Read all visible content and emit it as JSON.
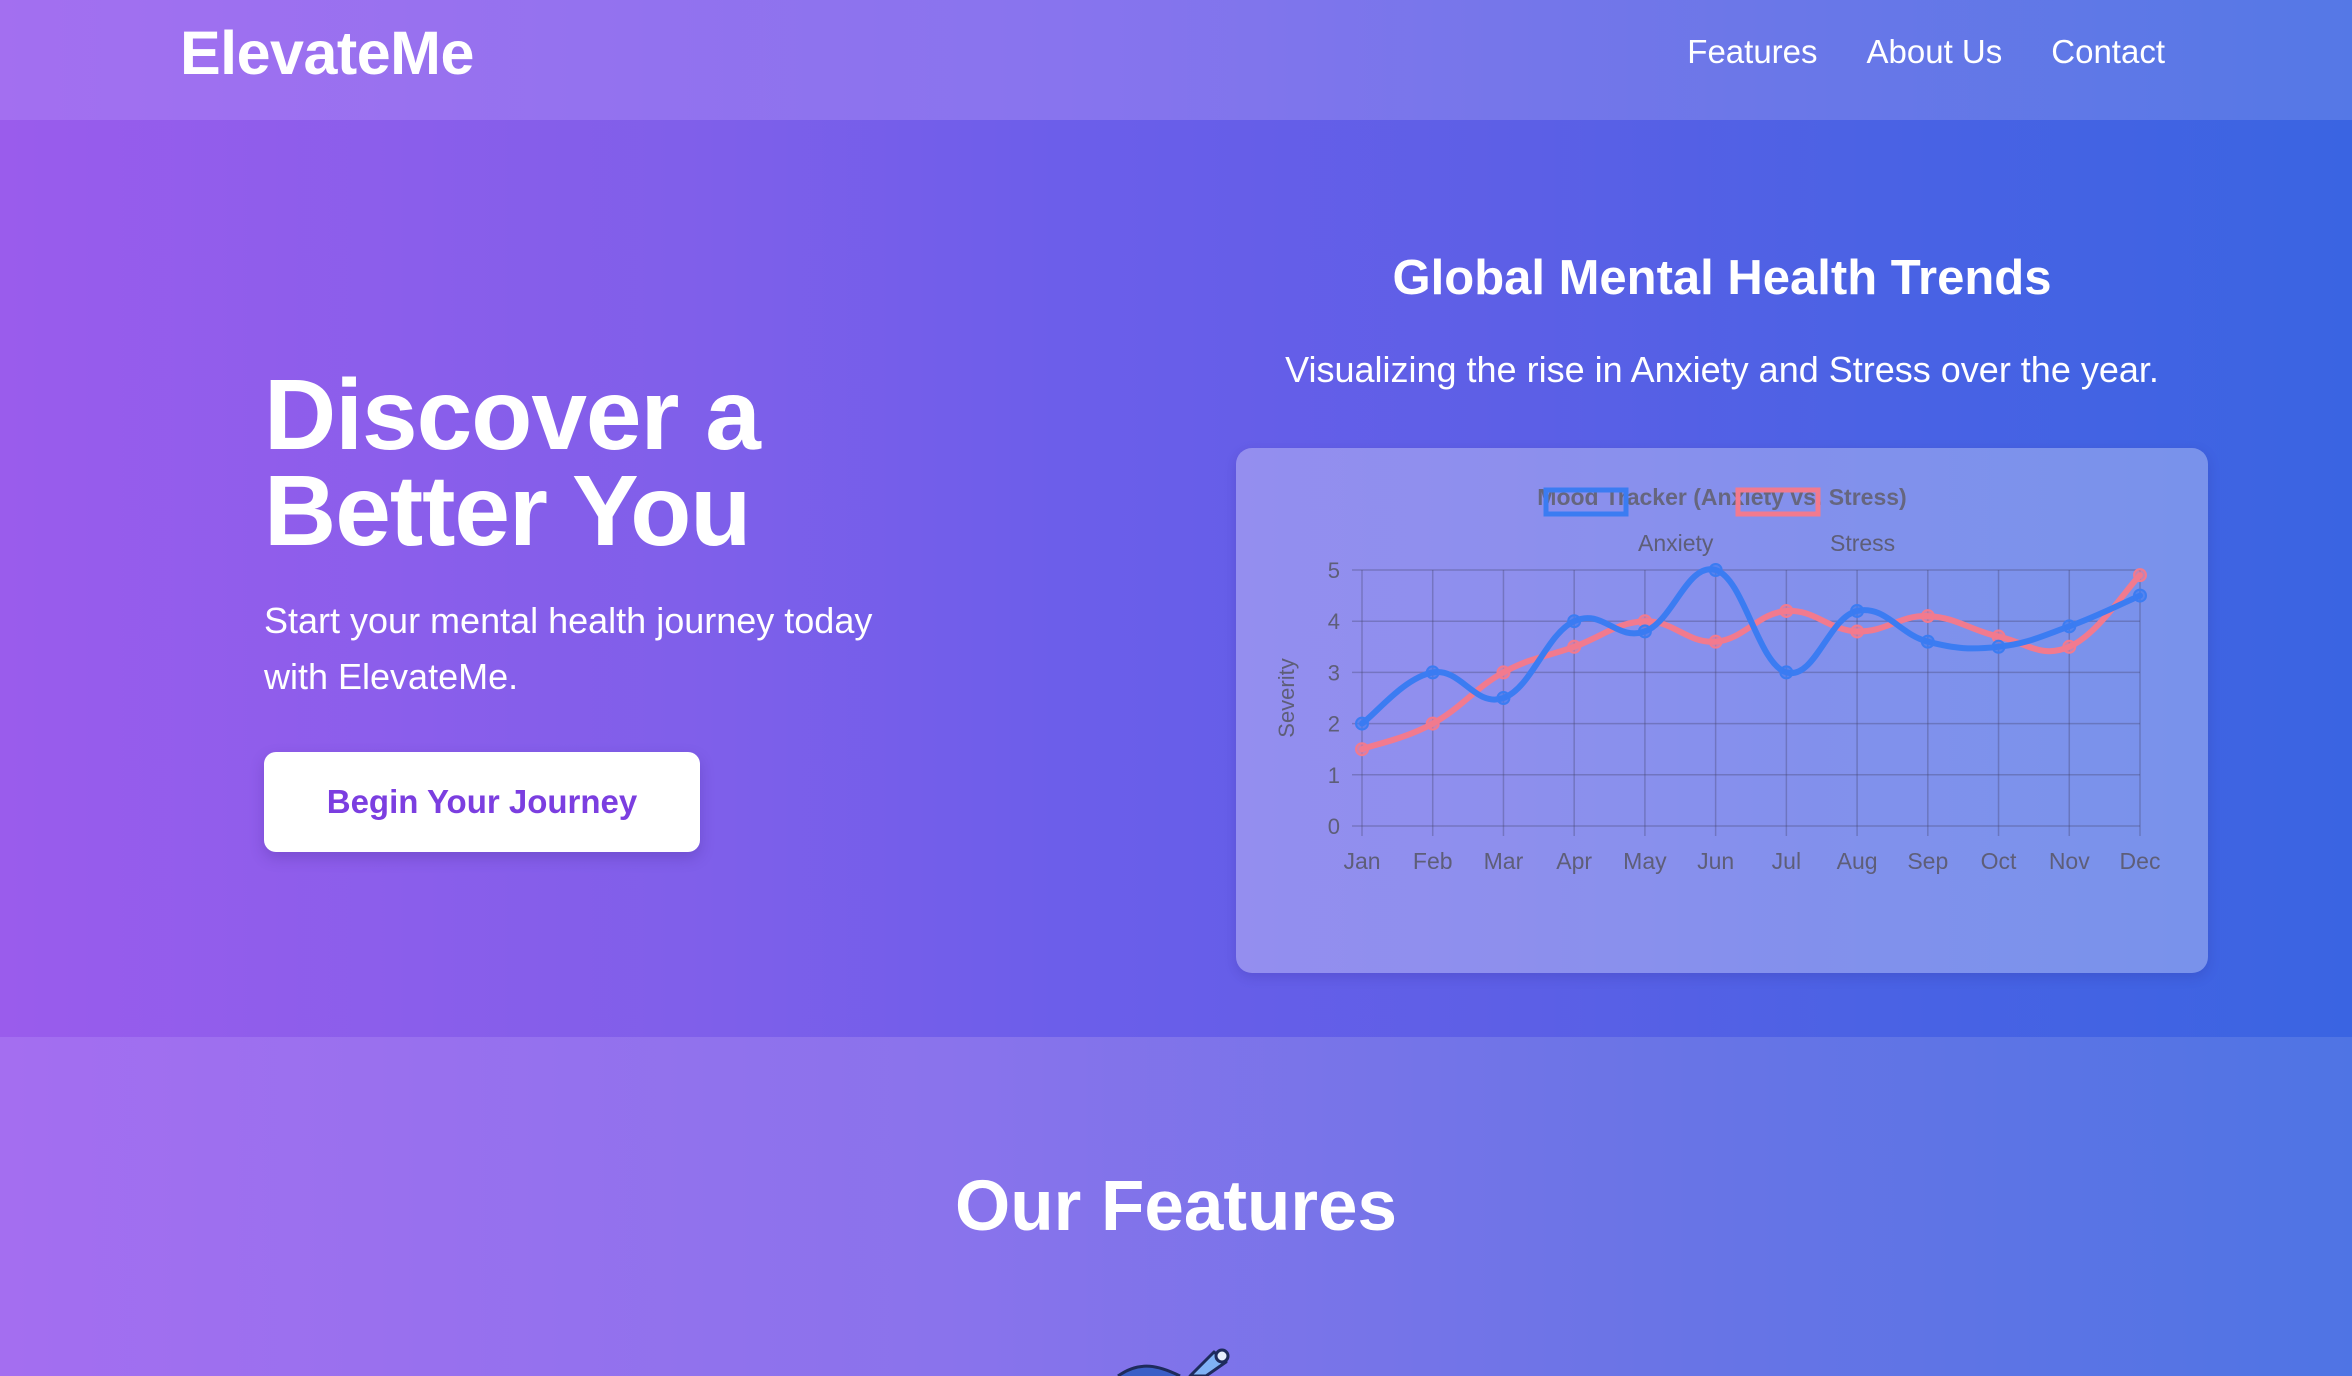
{
  "header": {
    "logo": "ElevateMe",
    "nav": [
      {
        "label": "Features"
      },
      {
        "label": "About Us"
      },
      {
        "label": "Contact"
      }
    ]
  },
  "hero": {
    "title_line1": "Discover a",
    "title_line2": "Better You",
    "subtitle": "Start your mental health journey today with ElevateMe.",
    "cta_label": "Begin Your Journey"
  },
  "trends": {
    "title": "Global Mental Health Trends",
    "subtitle": "Visualizing the rise in Anxiety and Stress over the year."
  },
  "chart_data": {
    "type": "line",
    "title": "Mood Tracker (Anxiety vs. Stress)",
    "xlabel": "",
    "ylabel": "Severity",
    "ylim": [
      0,
      5
    ],
    "yticks": [
      0,
      1,
      2,
      3,
      4,
      5
    ],
    "grid": true,
    "legend": "top-center",
    "categories": [
      "Jan",
      "Feb",
      "Mar",
      "Apr",
      "May",
      "Jun",
      "Jul",
      "Aug",
      "Sep",
      "Oct",
      "Nov",
      "Dec"
    ],
    "series": [
      {
        "name": "Anxiety",
        "color": "#3b7cf2",
        "values": [
          2,
          3,
          2.5,
          4,
          3.8,
          5,
          3,
          4.2,
          3.6,
          3.5,
          3.9,
          4.5
        ]
      },
      {
        "name": "Stress",
        "color": "#f27a8e",
        "values": [
          1.5,
          2,
          3,
          3.5,
          4,
          3.6,
          4.2,
          3.8,
          4.1,
          3.7,
          3.5,
          4.9
        ]
      }
    ]
  },
  "features": {
    "title": "Our Features",
    "icon": "brush-icon"
  },
  "colors": {
    "accent": "#7b3ee0",
    "anxiety": "#3b7cf2",
    "stress": "#f27a8e"
  }
}
